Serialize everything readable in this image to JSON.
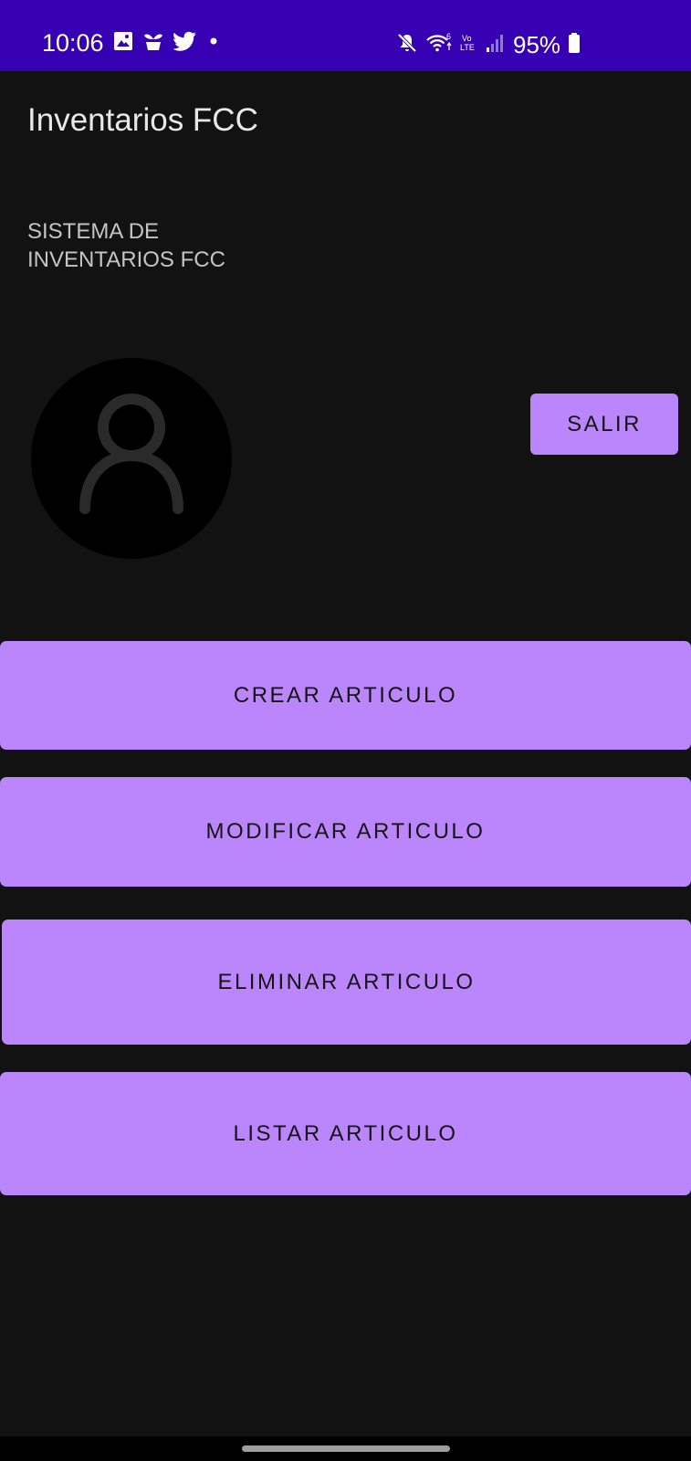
{
  "status_bar": {
    "time": "10:06",
    "left_icons": [
      "image-icon",
      "plant-icon",
      "twitter-icon",
      "dot-icon"
    ],
    "right_icons": [
      "mute-icon",
      "wifi-icon",
      "volte-icon",
      "signal-icon",
      "battery-icon"
    ],
    "volte_label_top": "Vo",
    "volte_label_bottom": "LTE",
    "battery_percent": "95%"
  },
  "app_bar": {
    "title": "Inventarios FCC"
  },
  "main": {
    "subtitle": "SISTEMA DE INVENTARIOS FCC",
    "avatar_icon": "person-outline-icon",
    "salir_label": "SALIR",
    "crear_label": "CREAR ARTICULO",
    "modificar_label": "MODIFICAR ARTICULO",
    "eliminar_label": "ELIMINAR ARTICULO",
    "listar_label": "LISTAR ARTICULO"
  },
  "colors": {
    "status_bar_bg": "#3700b3",
    "background": "#121212",
    "button_bg": "#bb86fc",
    "button_text": "#141414",
    "title_text": "#e8e8e8"
  }
}
